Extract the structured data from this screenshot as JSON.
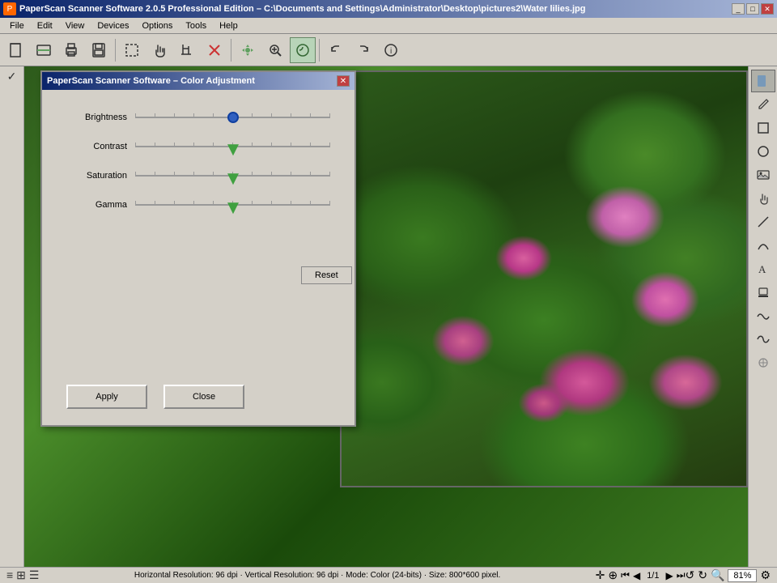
{
  "app": {
    "title": "PaperScan Scanner Software 2.0.5 Professional Edition – C:\\Documents and Settings\\Administrator\\Desktop\\pictures2\\Water lilies.jpg",
    "dialog_title": "PaperScan Scanner Software – Color Adjustment"
  },
  "menu": {
    "items": [
      "File",
      "Edit",
      "View",
      "Devices",
      "Options",
      "Tools",
      "Help"
    ]
  },
  "dialog": {
    "title": "PaperScan Scanner Software – Color Adjustment",
    "sliders": [
      {
        "label": "Brightness",
        "thumb_type": "blue",
        "position_pct": 50
      },
      {
        "label": "Contrast",
        "thumb_type": "green",
        "position_pct": 50
      },
      {
        "label": "Saturation",
        "thumb_type": "green",
        "position_pct": 50
      },
      {
        "label": "Gamma",
        "thumb_type": "green",
        "position_pct": 50
      }
    ],
    "reset_label": "Reset",
    "apply_label": "Apply",
    "close_label": "Close"
  },
  "status": {
    "text": "Horizontal Resolution: 96 dpi · Vertical Resolution: 96 dpi · Mode: Color (24-bits) · Size: 800*600 pixel.",
    "page": "1/1",
    "zoom": "81%"
  },
  "toolbar": {
    "buttons": [
      "📄",
      "🖨",
      "💾",
      "📋",
      "✂",
      "↩",
      "🔍",
      "🔎",
      "✔",
      "✖",
      "⬛",
      "⭕",
      "🖼",
      "🔧",
      "〰",
      "〰",
      "↺",
      "↻",
      "ℹ"
    ]
  },
  "right_toolbar": {
    "buttons": [
      "▭",
      "✏",
      "◯",
      "🖼",
      "🤚",
      "〰",
      "〰",
      "〰",
      "A",
      "📋",
      "〰",
      "〰"
    ]
  }
}
